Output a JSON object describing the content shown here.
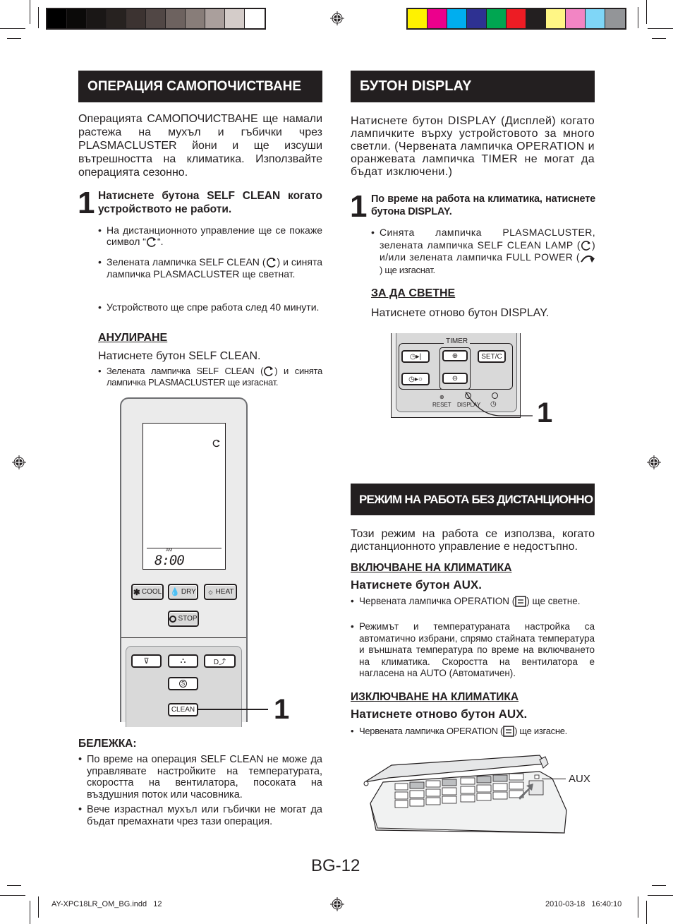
{
  "print_marks": {
    "gray_swatches": [
      "#000000",
      "#0b0a09",
      "#1a1716",
      "#272220",
      "#3c3331",
      "#514745",
      "#6d625f",
      "#887d79",
      "#aa9f9c",
      "#d4ccc9",
      "#ffffff"
    ],
    "color_swatches": [
      "#fff200",
      "#ec008c",
      "#00aeef",
      "#2e3192",
      "#00a651",
      "#ed1c24",
      "#231f20",
      "#fff685",
      "#f285c4",
      "#7fd6f7",
      "#939598"
    ],
    "footer_file": "AY-XPC18LR_OM_BG.indd   12",
    "footer_timestamp": "2010-03-18   16:40:10"
  },
  "left": {
    "title": "ОПЕРАЦИЯ САМОПОЧИСТВАНЕ",
    "intro": "Операцията САМОПОЧИСТВАНЕ ще намали растежа на мухъл и гъбички чрез PLASMACLUSTER йони и ще изсуши вътрешността на климатика. Използвайте операцията сезонно.",
    "step1_num": "1",
    "step1_text": "Натиснете бутона SELF CLEAN когато устройството не работи.",
    "bullets": [
      {
        "before": "На дистанционното управление ще се покаже символ “",
        "after": "“."
      },
      {
        "before": "Зелената лампичка SELF CLEAN (",
        "after": ") и синята лампичка PLASMACLUSTER ще светнат."
      },
      {
        "before": "Устройството ще спре работа след 40 минути.",
        "after": ""
      }
    ],
    "cancel_head": "АНУЛИРАНЕ",
    "cancel_text": "Натиснете бутон SELF CLEAN.",
    "cancel_bullet_before": "Зелената лампичка SELF CLEAN (",
    "cancel_bullet_after": ") и синята лампичка PLASMACLUSTER ще изгаснат.",
    "remote": {
      "lcd_am": "AM",
      "lcd_time": "8:00",
      "buttons": {
        "cool": "COOL",
        "dry": "DRY",
        "heat": "HEAT",
        "stop": "STOP",
        "clean": "CLEAN"
      }
    },
    "callout": "1",
    "note_head": "БЕЛЕЖКА:",
    "notes": [
      "По време на операция SELF CLEAN не може да управлявате настройките на температурата, скоростта на вентилатора, посоката на въздушния поток или часовника.",
      "Вече израстнал мухъл или гъбички не могат да бъдат премахнати чрез тази операция."
    ]
  },
  "right": {
    "display_title": "БУТОН DISPLAY",
    "display_intro": "Натиснете бутон DISPLAY (Дисплей) когато лампичките върху устройстовото за много светли. (Червената лампичка OPERATION и оранжевата лампичка TIMER не могат да бъдат изключени.)",
    "step1_num": "1",
    "step1_text": "По време на работа на климатика, натиснете бутона DISPLAY.",
    "bullet_a": "Синята лампичка PLASMACLUSTER, зелената лампичка SELF CLEAN LAMP (",
    "bullet_b": ") и/или зелената лампичка FULL POWER (",
    "bullet_c": ") ще изгаснат.",
    "light_head": "ЗА ДА СВЕТНЕ",
    "light_text": "Натиснете отново бутон DISPLAY.",
    "remote2": {
      "timer": "TIMER",
      "setc": "SET/C",
      "reset": "RESET",
      "display": "DISPLAY"
    },
    "callout": "1",
    "aux_title": "РЕЖИМ НА РАБОТА БЕЗ ДИСТАНЦИОННО",
    "aux_intro": "Този режим на работа се използва, когато дистанционното управление е недостъпно.",
    "on_head": "ВКЛЮЧВАНЕ НА КЛИМАТИКА",
    "on_action": "Натиснете бутон AUX.",
    "on_bullet1_before": "Червената лампичка OPERATION (",
    "on_bullet1_after": ") ще светне.",
    "on_bullet2": "Режимът и температураната настройка са автоматично избрани, спрямо стайната температура и външната температура по време на включването на климатика. Скоростта на вентилатора е нагласена на AUTO (Автоматичен).",
    "off_head": "ИЗКЛЮЧВАНЕ НА КЛИМАТИКА",
    "off_action": "Натиснете отново бутон AUX.",
    "off_bullet_before": "Червената лампичка OPERATION (",
    "off_bullet_after": ") ще изгасне.",
    "aux_label": "AUX"
  },
  "page_number": "BG-12"
}
